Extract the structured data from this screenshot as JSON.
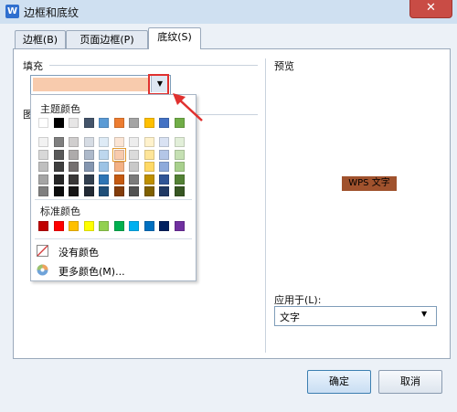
{
  "window": {
    "title": "边框和底纹",
    "app_icon": "W",
    "close_glyph": "✕"
  },
  "tabs": [
    {
      "label": "边框(B)"
    },
    {
      "label": "页面边框(P)"
    },
    {
      "label": "底纹(S)",
      "active": true
    }
  ],
  "fill": {
    "section_label": "填充",
    "selected_color": "#F8CBAD"
  },
  "pattern": {
    "section_label_partial": "图"
  },
  "palette": {
    "theme_title": "主题颜色",
    "theme_colors": [
      "#FFFFFF",
      "#000000",
      "#E7E6E6",
      "#44546A",
      "#5B9BD5",
      "#ED7D31",
      "#A5A5A5",
      "#FFC000",
      "#4472C4",
      "#70AD47"
    ],
    "tint_rows": [
      [
        "#F2F2F2",
        "#7F7F7F",
        "#D0CECE",
        "#D6DCE4",
        "#DEEBF6",
        "#FBE5D5",
        "#EDEDED",
        "#FFF2CC",
        "#D9E2F3",
        "#E2EFD9"
      ],
      [
        "#D8D8D8",
        "#595959",
        "#AEABAB",
        "#ADB9CA",
        "#BDD7EE",
        "#F8CBAD",
        "#DBDBDB",
        "#FEE599",
        "#B4C6E7",
        "#C5E0B3"
      ],
      [
        "#BFBFBF",
        "#3F3F3F",
        "#757070",
        "#8496B0",
        "#9CC3E5",
        "#F4B183",
        "#C9C9C9",
        "#FFD965",
        "#8EAADB",
        "#A8D08D"
      ],
      [
        "#A5A5A5",
        "#262626",
        "#3A3838",
        "#323F4F",
        "#2E75B5",
        "#C55A11",
        "#7B7B7B",
        "#BF9000",
        "#2F5496",
        "#538135"
      ],
      [
        "#7F7F7F",
        "#0C0C0C",
        "#171616",
        "#222A35",
        "#1E4E79",
        "#833C0B",
        "#525252",
        "#7F6000",
        "#1F3864",
        "#375623"
      ]
    ],
    "selected": {
      "row": 1,
      "col": 5
    },
    "standard_title": "标准颜色",
    "standard_colors": [
      "#C00000",
      "#FF0000",
      "#FFC000",
      "#FFFF00",
      "#92D050",
      "#00B050",
      "#00B0F0",
      "#0070C0",
      "#002060",
      "#7030A0"
    ],
    "no_color_label": "没有颜色",
    "more_colors_label": "更多颜色(M)..."
  },
  "preview": {
    "section_label": "预览",
    "sample_text": "WPS 文字"
  },
  "apply_to": {
    "label": "应用于(L):",
    "value": "文字"
  },
  "buttons": {
    "ok": "确定",
    "cancel": "取消"
  },
  "colors": {
    "highlight": "#E0312F",
    "annotation_arrow": "#E0312F"
  }
}
